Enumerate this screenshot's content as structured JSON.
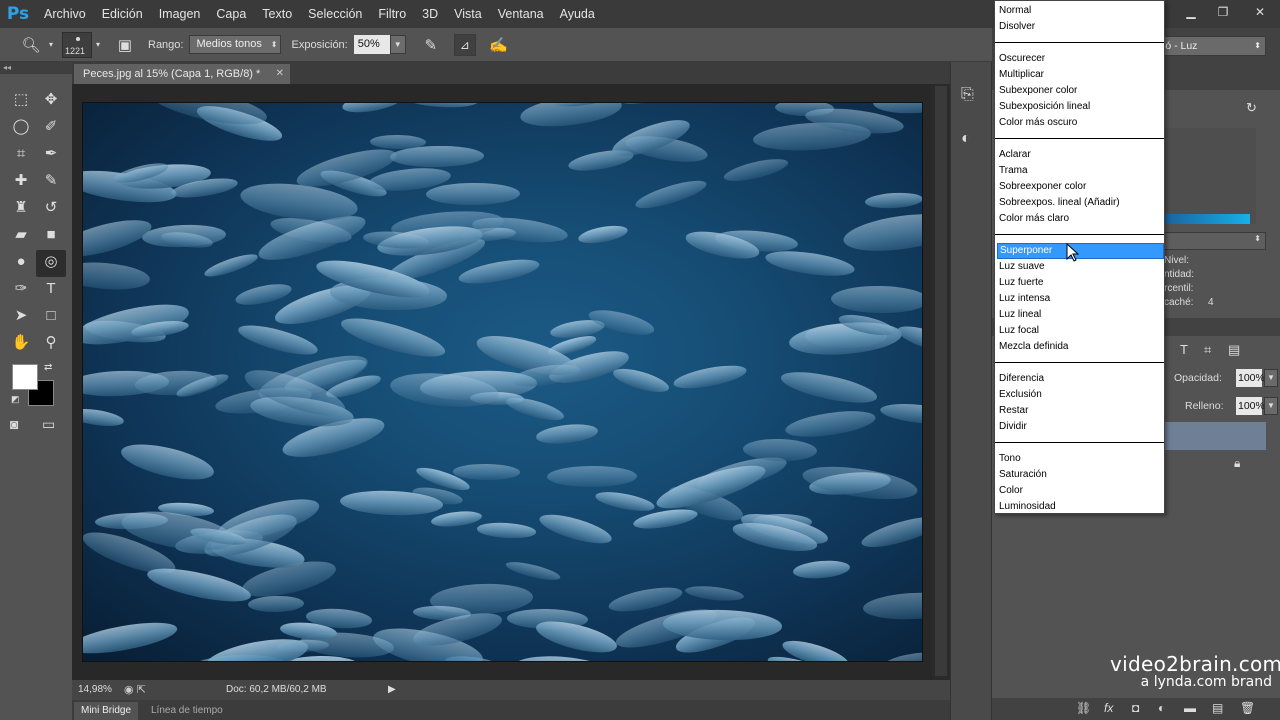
{
  "app": {
    "logo": "Ps"
  },
  "menu": [
    "Archivo",
    "Edición",
    "Imagen",
    "Capa",
    "Texto",
    "Selección",
    "Filtro",
    "3D",
    "Vista",
    "Ventana",
    "Ayuda"
  ],
  "options": {
    "brush_size": "1221",
    "range_label": "Rango:",
    "range_value": "Medios tonos",
    "exposure_label": "Exposición:",
    "exposure_value": "50%"
  },
  "document": {
    "tab_title": "Peces.jpg al 15% (Capa 1, RGB/8) *",
    "zoom": "14,98%",
    "doc_info": "Doc: 60,2 MB/60,2 MB"
  },
  "bottom_tabs": [
    "Mini Bridge",
    "Línea de tiempo"
  ],
  "right_panel": {
    "preset_value": "ió - Luz",
    "histogram_labels": {
      "level": "Nivel:",
      "amount": "ntidad:",
      "percentile": "rcentil:",
      "cache": "caché:",
      "cache_value": "4"
    },
    "opacity_label": "Opacidad:",
    "opacity_value": "100%",
    "fill_label": "Relleno:",
    "fill_value": "100%"
  },
  "blend_modes": {
    "groups": [
      [
        "Normal",
        "Disolver"
      ],
      [
        "Oscurecer",
        "Multiplicar",
        "Subexponer color",
        "Subexposición lineal",
        "Color más oscuro"
      ],
      [
        "Aclarar",
        "Trama",
        "Sobreexponer color",
        "Sobreexpos. lineal (Añadir)",
        "Color más claro"
      ],
      [
        "Superponer",
        "Luz suave",
        "Luz fuerte",
        "Luz intensa",
        "Luz lineal",
        "Luz focal",
        "Mezcla definida"
      ],
      [
        "Diferencia",
        "Exclusión",
        "Restar",
        "Dividir"
      ],
      [
        "Tono",
        "Saturación",
        "Color",
        "Luminosidad"
      ]
    ],
    "selected": "Superponer",
    "selected_color": "#3399ff"
  },
  "watermark": {
    "line1": "video2brain.com",
    "line2": "a lynda.com brand"
  },
  "colors": {
    "foreground": "#ffffff",
    "background": "#000000",
    "logo": "#2ba3e8"
  },
  "icons": {
    "tools": [
      "marquee-icon",
      "move-icon",
      "lasso-icon",
      "quick-select-icon",
      "crop-icon",
      "eyedropper-icon",
      "healing-icon",
      "brush-icon",
      "stamp-icon",
      "history-brush-icon",
      "eraser-icon",
      "gradient-icon",
      "blur-icon",
      "sponge-icon",
      "pen-icon",
      "type-icon",
      "path-select-icon",
      "rectangle-icon",
      "hand-icon",
      "zoom-icon"
    ]
  }
}
